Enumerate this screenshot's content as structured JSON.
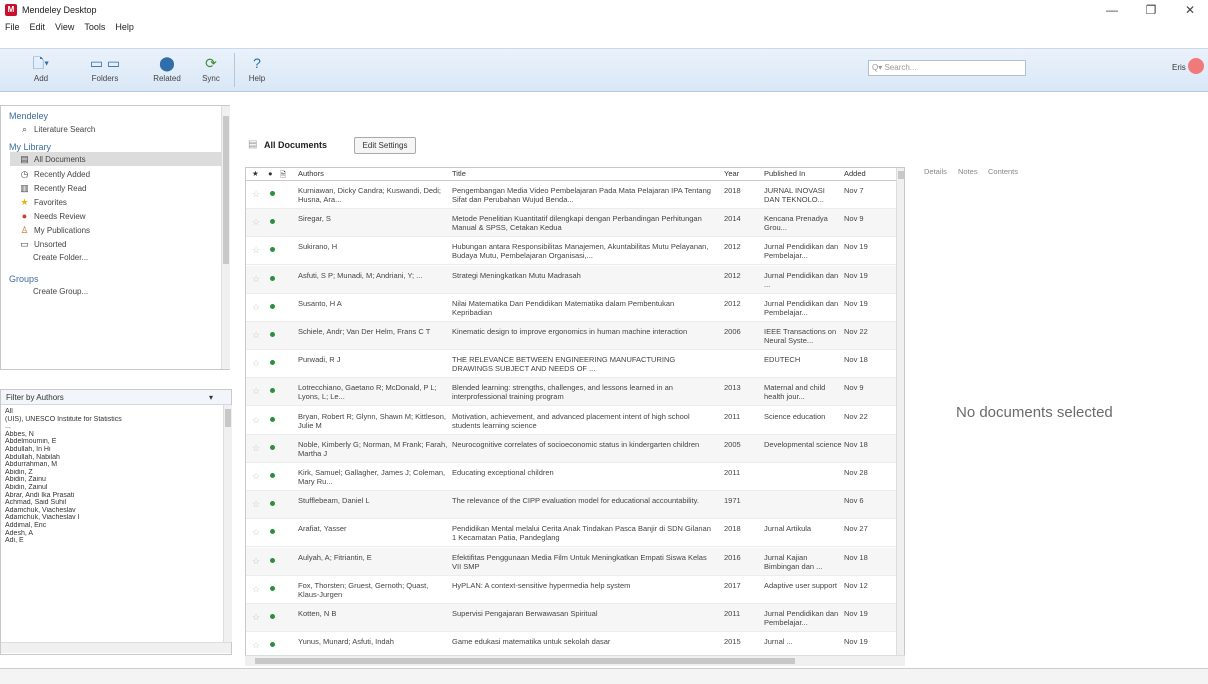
{
  "window": {
    "title": "Mendeley Desktop",
    "logo": "M",
    "minimize": "—",
    "maximize": "❐",
    "close": "✕"
  },
  "menu": [
    "File",
    "Edit",
    "View",
    "Tools",
    "Help"
  ],
  "toolbar": {
    "add_label": "Add",
    "folders_label": "Folders",
    "related_label": "Related",
    "sync_label": "Sync",
    "help_label": "Help",
    "search_placeholder": "Q▾ Search...",
    "user_name": "Eris"
  },
  "sidebar": {
    "section_mendeley": "Mendeley",
    "literature_search": "Literature Search",
    "section_my_library": "My Library",
    "items": [
      "All Documents",
      "Recently Added",
      "Recently Read",
      "Favorites",
      "Needs Review",
      "My Publications",
      "Unsorted",
      "Create Folder..."
    ],
    "section_groups": "Groups",
    "create_group": "Create Group..."
  },
  "filter": {
    "label": "Filter by Authors",
    "authors": [
      "All",
      "(UIS), UNESCO Institute for Statistics",
      "...",
      "Abbes, N",
      "Abdelmoumin, E",
      "Abdullah, In Hi",
      "Abdullah, Nabilah",
      "Abdurrahman, M",
      "Abidin, Z",
      "Abidin, Zainu",
      "Abidin, Zainul",
      "Abrar, Andi Ika Prasati",
      "Achmad, Said Suhil",
      "Adamchuk, Viacheslav",
      "Adamchuk, Viacheslav I",
      "Addimal, Eric",
      "Adesh, A",
      "Adi, E"
    ]
  },
  "docs": {
    "title": "All Documents",
    "edit_settings": "Edit Settings",
    "columns": {
      "star": "★",
      "read": "●",
      "file": "🗎",
      "authors": "Authors",
      "title": "Title",
      "year": "Year",
      "published_in": "Published In",
      "added": "Added"
    },
    "rows": [
      {
        "authors": "Kurniawan, Dicky Candra; Kuswandi, Dedi; Husna, Ara...",
        "title": "Pengembangan Media Video Pembelajaran Pada Mata Pelajaran IPA Tentang Sifat dan Perubahan Wujud Benda...",
        "year": "2018",
        "published_in": "JURNAL INOVASI DAN TEKNOLO...",
        "added": "Nov 7"
      },
      {
        "authors": "Siregar, S",
        "title": "Metode Penelitian Kuantitatif dilengkapi dengan Perbandingan Perhitungan Manual & SPSS, Cetakan Kedua",
        "year": "2014",
        "published_in": "Kencana Prenadya Grou...",
        "added": "Nov 9"
      },
      {
        "authors": "Sukirano, H",
        "title": "Hubungan antara Responsibilitas Manajemen, Akuntabilitas Mutu Pelayanan, Budaya Mutu, Pembelajaran Organisasi,...",
        "year": "2012",
        "published_in": "Jurnal Pendidikan dan Pembelajar...",
        "added": "Nov 19"
      },
      {
        "authors": "Asfuti, S P; Munadi, M; Andriani, Y; ...",
        "title": "Strategi Meningkatkan Mutu Madrasah",
        "year": "2012",
        "published_in": "Jurnal Pendidikan dan ...",
        "added": "Nov 19"
      },
      {
        "authors": "Susanto, H A",
        "title": "Nilai Matematika Dan Pendidikan Matematika dalam Pembentukan Kepribadian",
        "year": "2012",
        "published_in": "Jurnal Pendidikan dan Pembelajar...",
        "added": "Nov 19"
      },
      {
        "authors": "Schiele, Andr; Van Der Helm, Frans C T",
        "title": "Kinematic design to improve ergonomics in human machine interaction",
        "year": "2006",
        "published_in": "IEEE Transactions on Neural Syste...",
        "added": "Nov 22"
      },
      {
        "authors": "Purwadi, R J",
        "title": "THE RELEVANCE BETWEEN ENGINEERING MANUFACTURING DRAWINGS SUBJECT AND NEEDS OF ...",
        "year": "",
        "published_in": "EDUTECH",
        "added": "Nov 18"
      },
      {
        "authors": "Lotrecchiano, Gaetano R; McDonald, P L; Lyons, L; Le...",
        "title": "Blended learning: strengths, challenges, and lessons learned in an interprofessional training program",
        "year": "2013",
        "published_in": "Maternal and child health jour...",
        "added": "Nov 9"
      },
      {
        "authors": "Bryan, Robert R; Glynn, Shawn M; Kittleson, Julie M",
        "title": "Motivation, achievement, and advanced placement intent of high school students learning science",
        "year": "2011",
        "published_in": "Science education",
        "added": "Nov 22"
      },
      {
        "authors": "Noble, Kimberly G; Norman, M Frank; Farah, Martha J",
        "title": "Neurocognitive correlates of socioeconomic status in kindergarten children",
        "year": "2005",
        "published_in": "Developmental science",
        "added": "Nov 18"
      },
      {
        "authors": "Kirk, Samuel; Gallagher, James J; Coleman, Mary Ru...",
        "title": "Educating exceptional children",
        "year": "2011",
        "published_in": "",
        "added": "Nov 28"
      },
      {
        "authors": "Stufflebeam, Daniel L",
        "title": "The relevance of the CIPP evaluation model for educational accountability.",
        "year": "1971",
        "published_in": "",
        "added": "Nov 6"
      },
      {
        "authors": "Arafiat, Yasser",
        "title": "Pendidikan Mental melalui Cerita Anak Tindakan Pasca Banjir di SDN Gilanan 1 Kecamatan Patia, Pandeglang",
        "year": "2018",
        "published_in": "Jurnal Artikula",
        "added": "Nov 27"
      },
      {
        "authors": "Aulyah, A; Fitriantin, E",
        "title": "Efektifitas Penggunaan Media Film Untuk Meningkatkan Empati Siswa Kelas VII SMP",
        "year": "2016",
        "published_in": "Jurnal Kajian Bimbingan dan ...",
        "added": "Nov 18"
      },
      {
        "authors": "Fox, Thorsten; Gruest, Gernoth; Quast, Klaus-Jurgen",
        "title": "HyPLAN: A context-sensitive hypermedia help system",
        "year": "2017",
        "published_in": "Adaptive user support",
        "added": "Nov 12"
      },
      {
        "authors": "Kotten, N B",
        "title": "Supervisi Pengajaran Berwawasan Spiritual",
        "year": "2011",
        "published_in": "Jurnal Pendidikan dan Pembelajar...",
        "added": "Nov 19"
      },
      {
        "authors": "Yunus, Munard; Asfuti, Indah",
        "title": "Game edukasi matematika untuk sekolah dasar",
        "year": "2015",
        "published_in": "Jurnal ...",
        "added": "Nov 19"
      }
    ]
  },
  "details": {
    "tabs": [
      "Details",
      "Notes",
      "Contents"
    ],
    "empty_message": "No documents selected"
  },
  "colors": {
    "accent": "#2f6ea8",
    "unread_dot": "#2d8f3c",
    "brand": "#c8102e"
  }
}
